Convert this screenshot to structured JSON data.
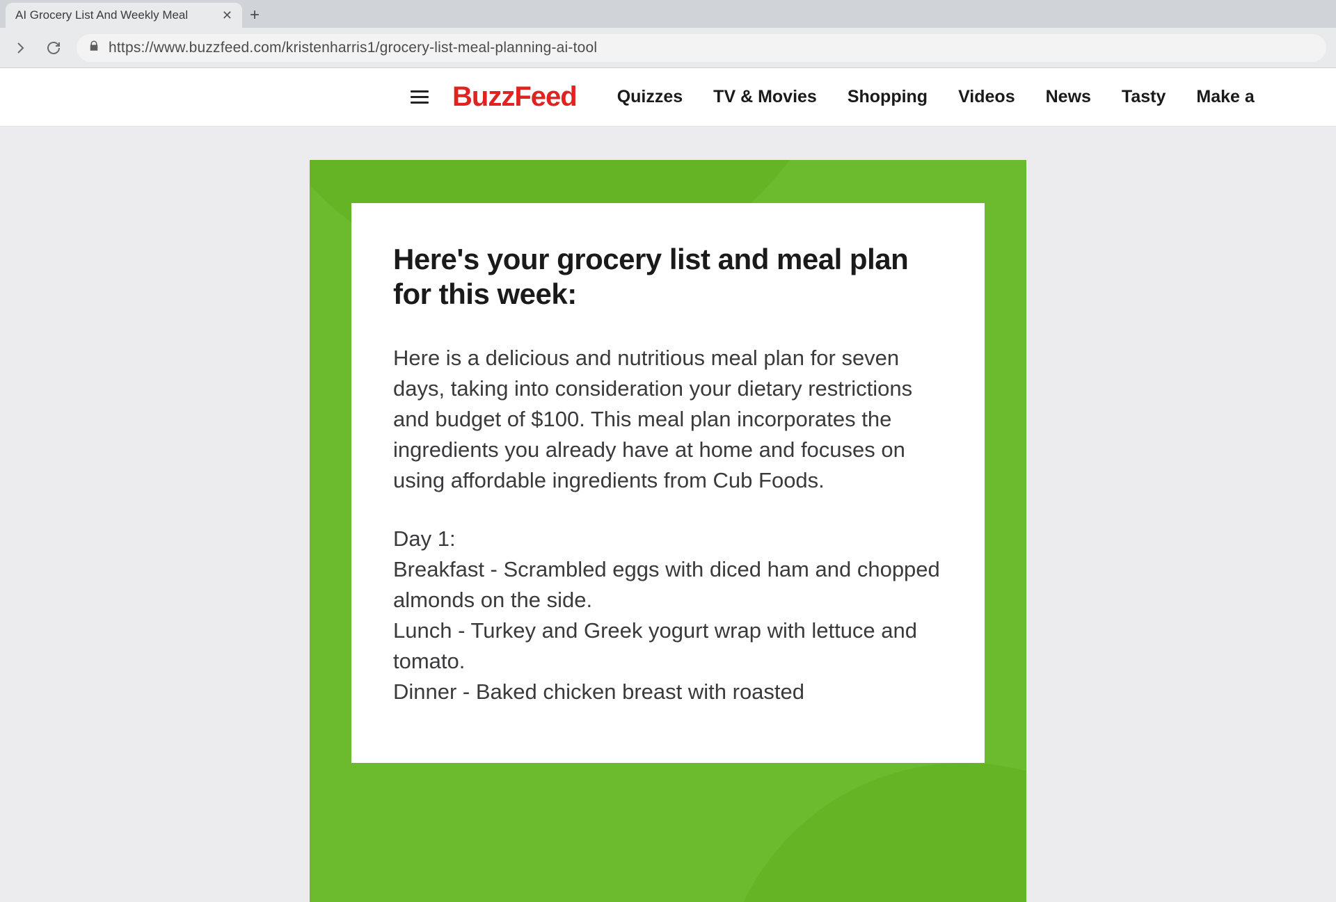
{
  "browser": {
    "tab_title": "AI Grocery List And Weekly Meal",
    "url": "https://www.buzzfeed.com/kristenharris1/grocery-list-meal-planning-ai-tool"
  },
  "header": {
    "logo": "BuzzFeed",
    "nav": [
      "Quizzes",
      "TV & Movies",
      "Shopping",
      "Videos",
      "News",
      "Tasty",
      "Make a"
    ]
  },
  "card": {
    "heading": "Here's your grocery list and meal plan for this week:",
    "intro": "Here is a delicious and nutritious meal plan for seven days, taking into consideration your dietary restrictions and budget of $100. This meal plan incorporates the ingredients you already have at home and focuses on using affordable ingredients from Cub Foods.",
    "day1_label": "Day 1:",
    "day1_breakfast": "Breakfast - Scrambled eggs with diced ham and chopped almonds on the side.",
    "day1_lunch": "Lunch - Turkey and Greek yogurt wrap with lettuce and tomato.",
    "day1_dinner": "Dinner - Baked chicken breast with roasted"
  }
}
